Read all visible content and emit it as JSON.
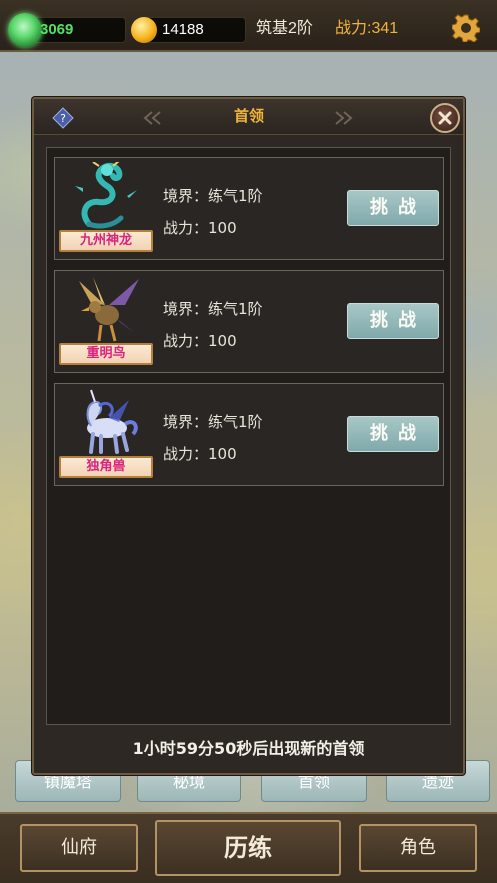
{
  "topbar": {
    "jade_value": "3069",
    "gold_value": "14188",
    "realm": "筑基2阶",
    "power": "战力:341",
    "colors": {
      "jade_text": "#4fe35f",
      "power_text": "#f0b43a"
    },
    "icons": [
      "jade-icon",
      "gold-coin-icon",
      "gear-icon"
    ]
  },
  "subtabs": [
    "镇魔塔",
    "秘境",
    "首领",
    "遗迹"
  ],
  "panel": {
    "title": "首领",
    "footer": "1小时59分50秒后出现新的首领",
    "icons": [
      "help-icon",
      "close-icon"
    ]
  },
  "bosses": [
    {
      "name": "九州神龙",
      "realm": "境界：练气1阶",
      "power": "战力：100",
      "button": "挑战",
      "portrait": "dragon"
    },
    {
      "name": "重明鸟",
      "realm": "境界：练气1阶",
      "power": "战力：100",
      "button": "挑战",
      "portrait": "bird"
    },
    {
      "name": "独角兽",
      "realm": "境界：练气1阶",
      "power": "战力：100",
      "button": "挑战",
      "portrait": "unicorn"
    }
  ],
  "bottom_nav": {
    "left": "仙府",
    "center": "历练",
    "right": "角色"
  }
}
